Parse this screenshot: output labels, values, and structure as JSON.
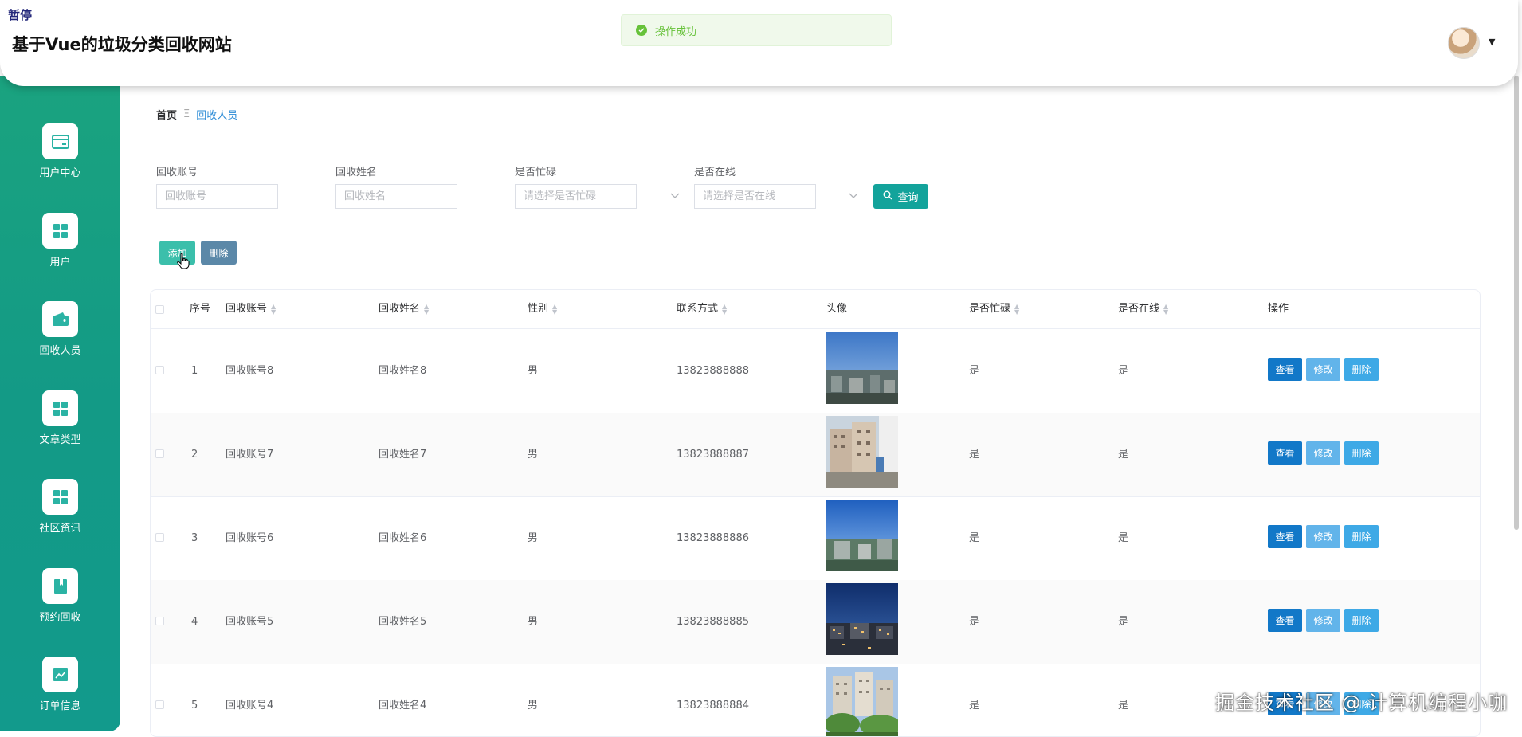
{
  "header": {
    "pause_tag": "暂停",
    "title": "基于Vue的垃圾分类回收网站"
  },
  "toast": {
    "message": "操作成功",
    "color": "#67c23a"
  },
  "sidebar": {
    "items": [
      {
        "label": "用户中心",
        "icon": "card-icon"
      },
      {
        "label": "用户",
        "icon": "grid-icon"
      },
      {
        "label": "回收人员",
        "icon": "wallet-icon"
      },
      {
        "label": "文章类型",
        "icon": "grid-icon"
      },
      {
        "label": "社区资讯",
        "icon": "grid-icon"
      },
      {
        "label": "预约回收",
        "icon": "book-icon"
      },
      {
        "label": "订单信息",
        "icon": "chart-icon"
      }
    ]
  },
  "breadcrumb": {
    "home": "首页",
    "separator": "Ξ",
    "current": "回收人员"
  },
  "filters": {
    "account_label": "回收账号",
    "account_placeholder": "回收账号",
    "name_label": "回收姓名",
    "name_placeholder": "回收姓名",
    "busy_label": "是否忙碌",
    "busy_placeholder": "请选择是否忙碌",
    "online_label": "是否在线",
    "online_placeholder": "请选择是否在线",
    "query_label": "查询"
  },
  "actions": {
    "add_label": "添加",
    "delete_label": "删除"
  },
  "table": {
    "headers": {
      "index": "序号",
      "account": "回收账号",
      "name": "回收姓名",
      "gender": "性别",
      "phone": "联系方式",
      "avatar": "头像",
      "busy": "是否忙碌",
      "online": "是否在线",
      "ops": "操作"
    },
    "rows": [
      {
        "index": "1",
        "account": "回收账号8",
        "name": "回收姓名8",
        "gender": "男",
        "phone": "13823888888",
        "busy": "是",
        "online": "是"
      },
      {
        "index": "2",
        "account": "回收账号7",
        "name": "回收姓名7",
        "gender": "男",
        "phone": "13823888887",
        "busy": "是",
        "online": "是"
      },
      {
        "index": "3",
        "account": "回收账号6",
        "name": "回收姓名6",
        "gender": "男",
        "phone": "13823888886",
        "busy": "是",
        "online": "是"
      },
      {
        "index": "4",
        "account": "回收账号5",
        "name": "回收姓名5",
        "gender": "男",
        "phone": "13823888885",
        "busy": "是",
        "online": "是"
      },
      {
        "index": "5",
        "account": "回收账号4",
        "name": "回收姓名4",
        "gender": "男",
        "phone": "13823888884",
        "busy": "是",
        "online": "是"
      }
    ],
    "op_view": "查看",
    "op_edit": "修改",
    "op_delete": "删除"
  },
  "watermark": "掘金技术社区 @ 计算机编程小咖"
}
